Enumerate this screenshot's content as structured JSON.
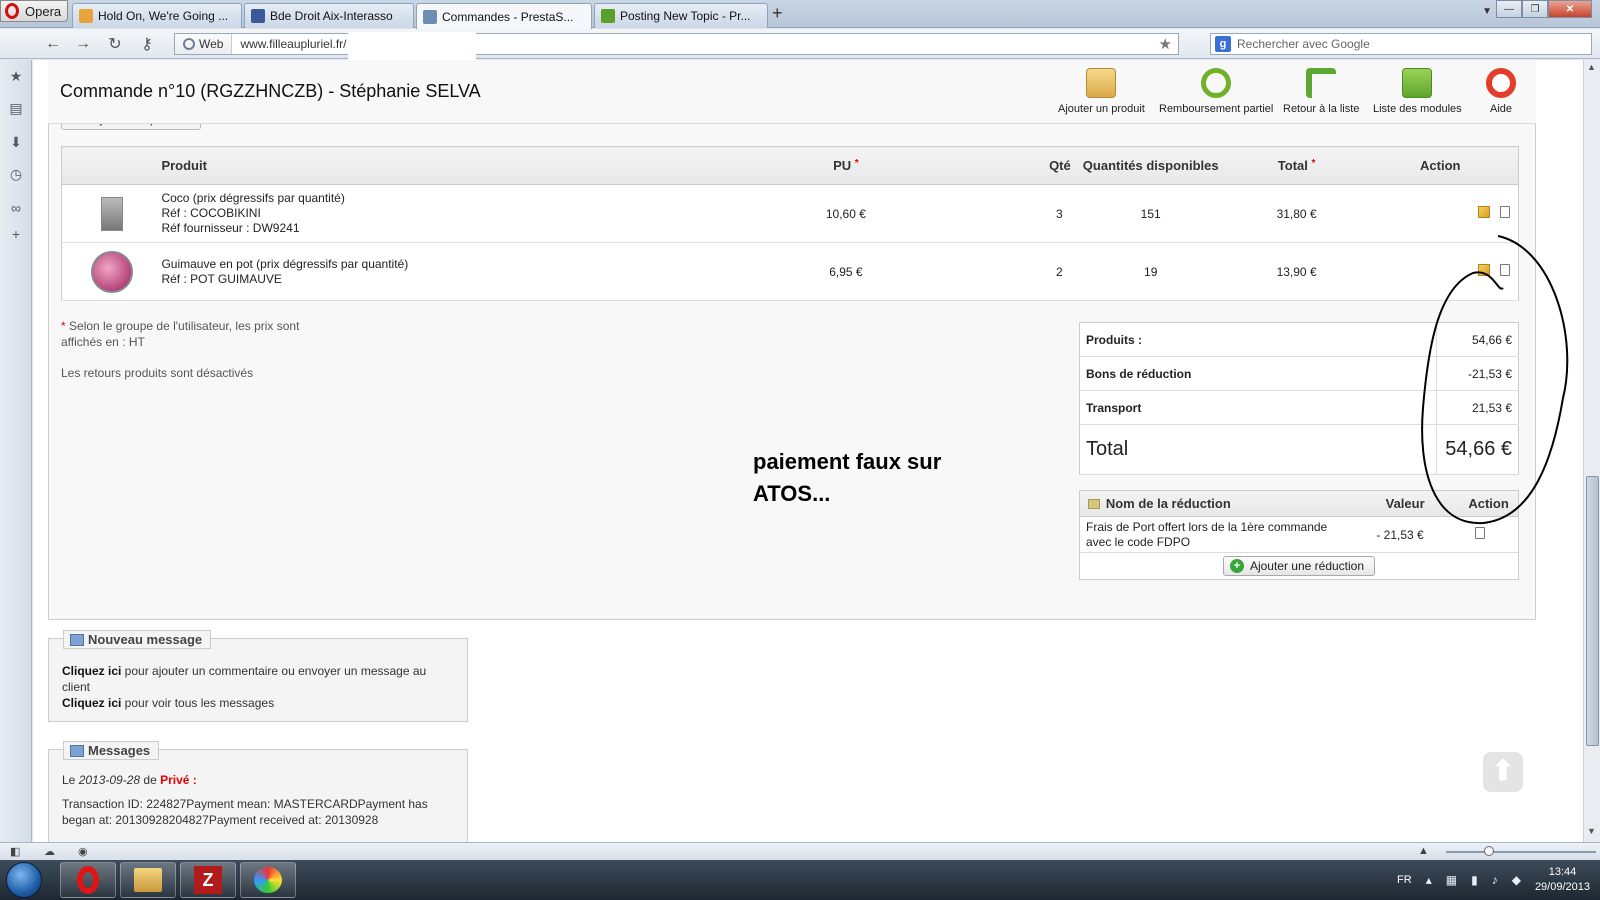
{
  "browser": {
    "app_name": "Opera",
    "tabs": [
      {
        "label": "Hold On, We're Going ...",
        "color": "#e8a33a"
      },
      {
        "label": "Bde Droit Aix-Interasso",
        "color": "#3b5998"
      },
      {
        "label": "Commandes - PrestaS...",
        "color": "#6a8fb3",
        "active": true
      },
      {
        "label": "Posting New Topic - Pr...",
        "color": "#5aa02c"
      }
    ],
    "new_tab": "+",
    "web_badge": "Web",
    "url": "www.filleaupluriel.fr/",
    "search_placeholder": "Rechercher avec Google"
  },
  "header": {
    "title": "Commande n°10 (RGZZHNCZB) - Stéphanie SELVA",
    "actions": [
      {
        "label": "Ajouter un produit"
      },
      {
        "label": "Remboursement partiel"
      },
      {
        "label": "Retour à la liste"
      },
      {
        "label": "Liste des modules"
      },
      {
        "label": "Aide"
      }
    ],
    "partial_button": "Ajouter un produit"
  },
  "products_table": {
    "headers": {
      "produit": "Produit",
      "pu": "PU",
      "qte": "Qté",
      "dispo": "Quantités disponibles",
      "total": "Total",
      "action": "Action"
    },
    "required_mark": "*",
    "rows": [
      {
        "name": "Coco (prix dégressifs par quantité)",
        "ref": "Réf : COCOBIKINI",
        "ref_fournisseur": "Réf fournisseur : DW9241",
        "pu": "10,60 €",
        "qte": "3",
        "dispo": "151",
        "total": "31,80 €"
      },
      {
        "name": "Guimauve en pot (prix dégressifs par quantité)",
        "ref": "Réf : POT GUIMAUVE",
        "ref_fournisseur": "",
        "pu": "6,95 €",
        "qte": "2",
        "dispo": "19",
        "total": "13,90 €"
      }
    ]
  },
  "notes": {
    "star": "*",
    "price_group": "Selon le groupe de l'utilisateur, les prix sont affichés en : HT",
    "returns": "Les retours produits sont désactivés"
  },
  "totals": [
    {
      "label": "Produits :",
      "value": "54,66 €"
    },
    {
      "label": "Bons de réduction",
      "value": "-21,53 €"
    },
    {
      "label": "Transport",
      "value": "21,53 €"
    },
    {
      "label": "Total",
      "value": "54,66 €"
    }
  ],
  "annotation": {
    "line1": "paiement faux sur",
    "line2": "ATOS..."
  },
  "discounts": {
    "headers": {
      "name": "Nom de la réduction",
      "value": "Valeur",
      "action": "Action"
    },
    "rows": [
      {
        "name": "Frais de Port offert lors de la 1ère commande avec le code FDPO",
        "value": "- 21,53 €"
      }
    ],
    "add_button": "Ajouter une réduction"
  },
  "new_message": {
    "legend": "Nouveau message",
    "link1": "Cliquez ici",
    "text1": " pour ajouter un commentaire ou envoyer un message au client",
    "link2": "Cliquez ici",
    "text2": " pour voir tous les messages"
  },
  "messages": {
    "legend": "Messages",
    "prefix": "Le ",
    "date": "2013-09-28",
    "de": " de ",
    "author": "Privé :",
    "body": "Transaction ID: 224827Payment mean: MASTERCARDPayment has began at: 20130928204827Payment received at: 20130928"
  },
  "taskbar": {
    "language": "FR",
    "time": "13:44",
    "date": "29/09/2013",
    "filezilla_label": "Z"
  }
}
